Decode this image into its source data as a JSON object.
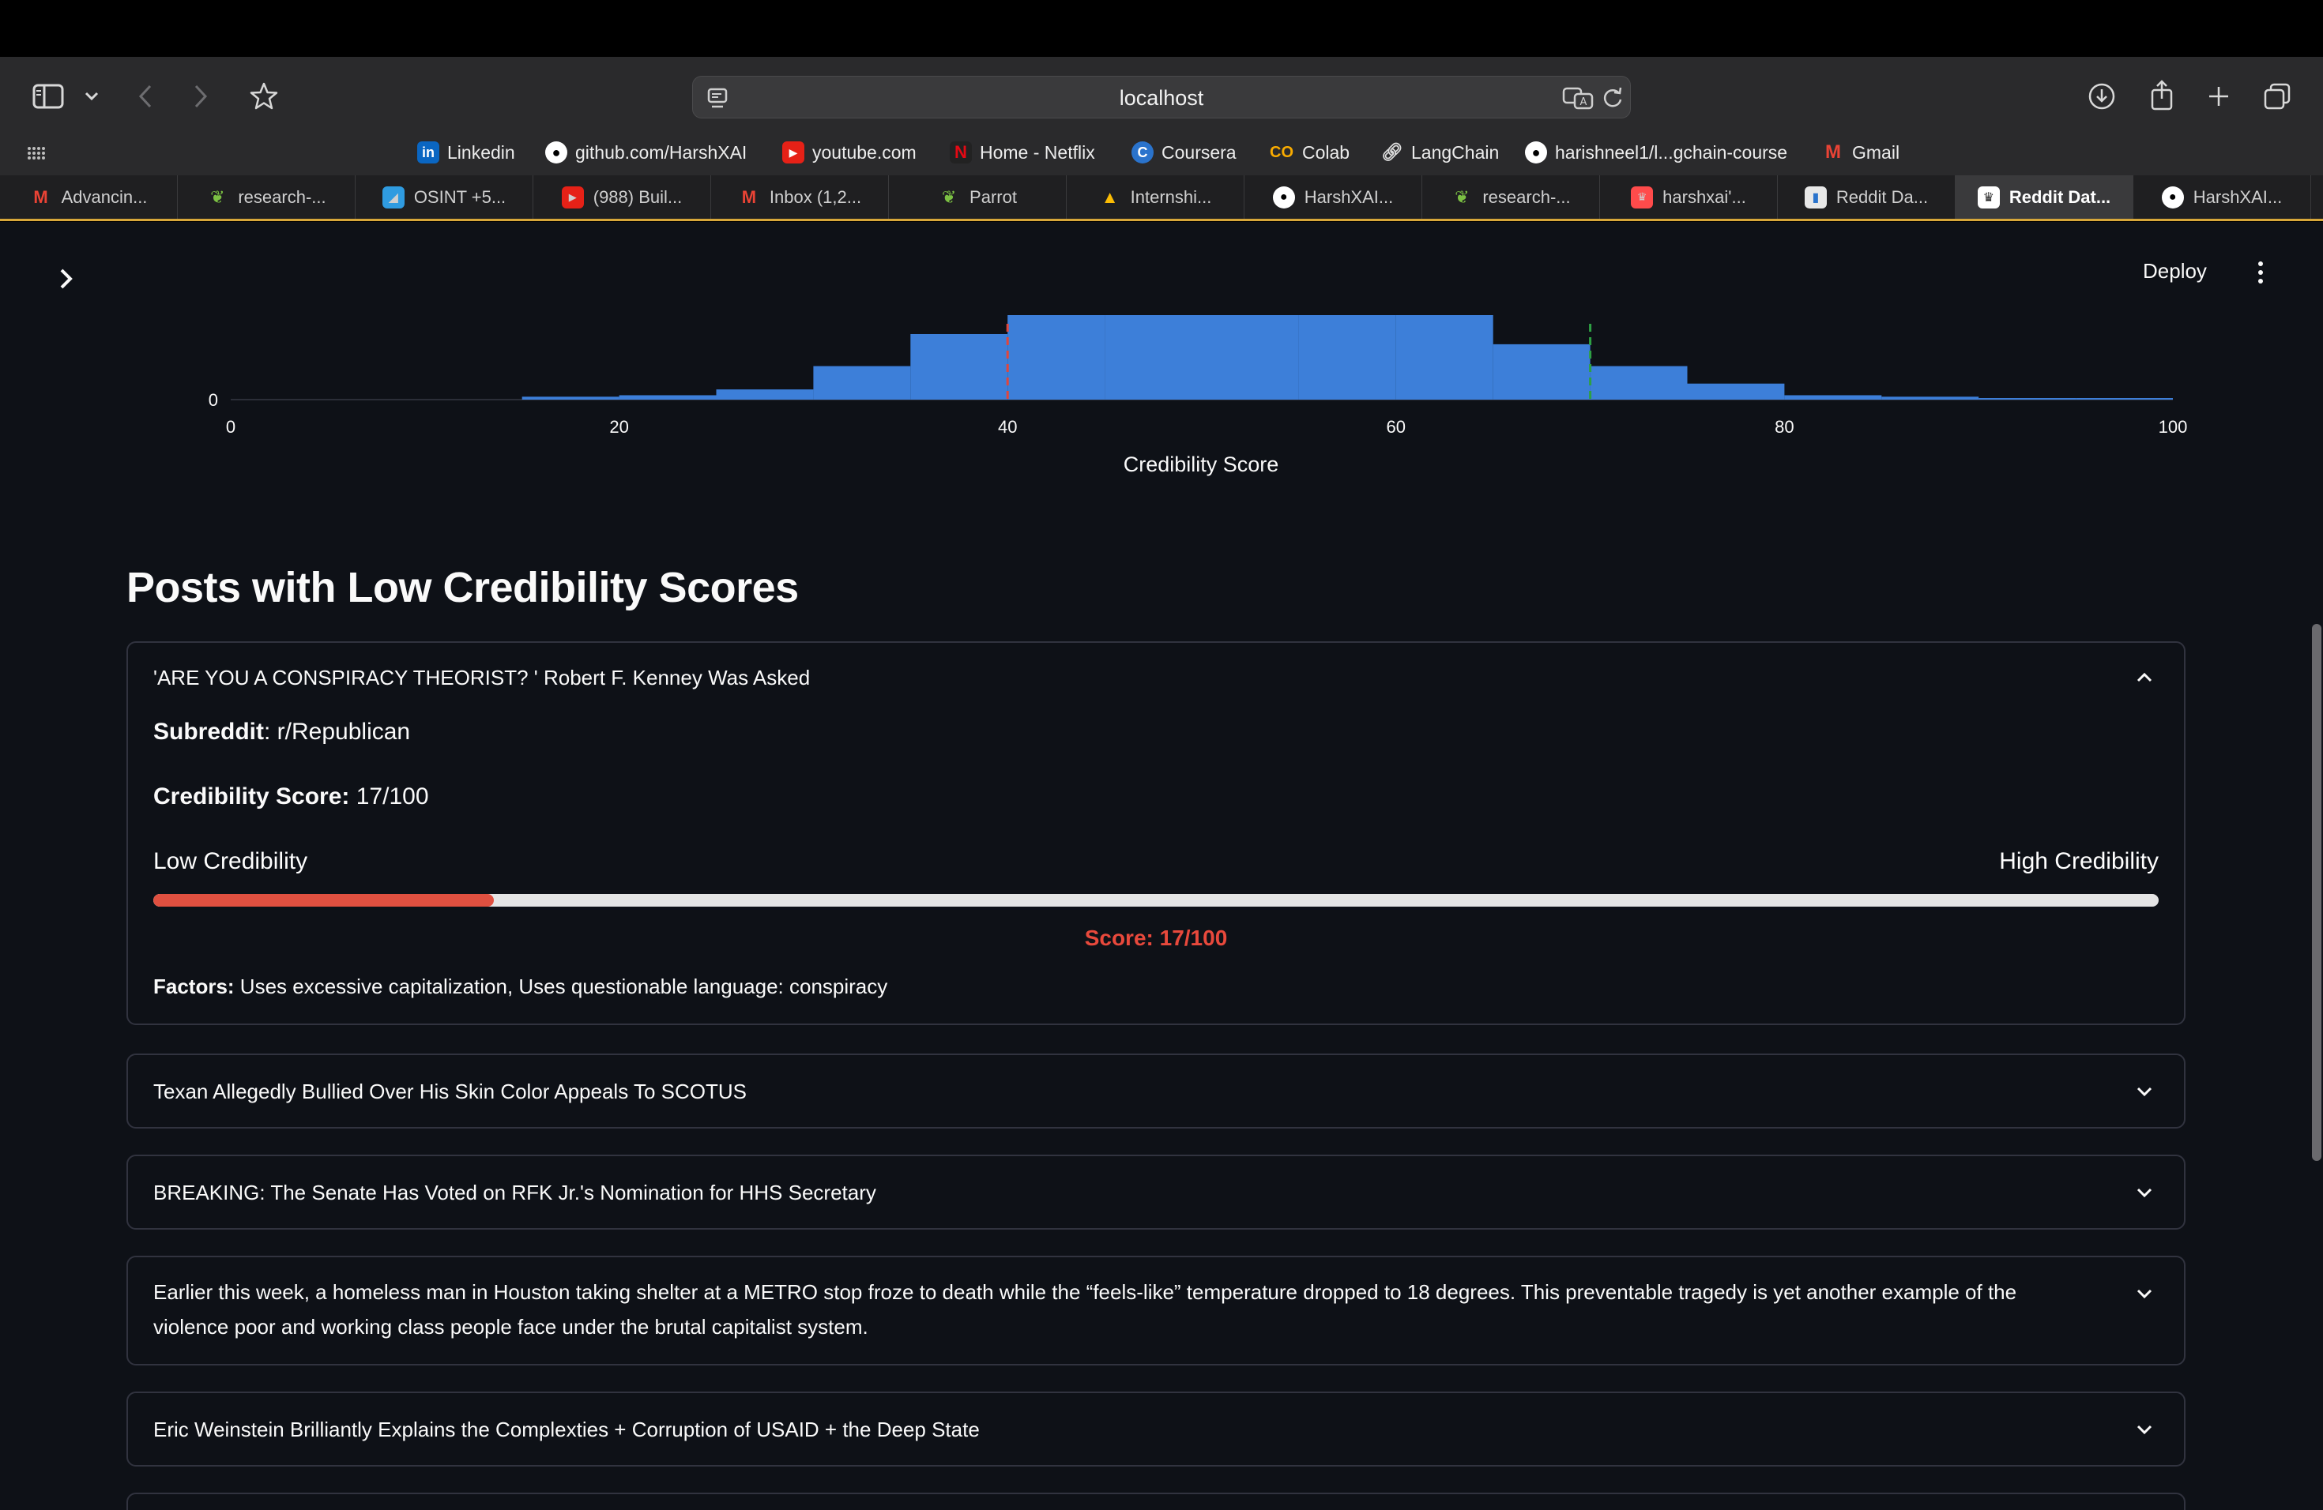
{
  "browser": {
    "url": "localhost",
    "bookmarks": [
      {
        "label": "Linkedin",
        "icon": "linkedin-icon"
      },
      {
        "label": "github.com/HarshXAI",
        "icon": "github-icon"
      },
      {
        "label": "youtube.com",
        "icon": "youtube-icon"
      },
      {
        "label": "Home - Netflix",
        "icon": "netflix-icon"
      },
      {
        "label": "Coursera",
        "icon": "coursera-icon"
      },
      {
        "label": "Colab",
        "icon": "colab-icon"
      },
      {
        "label": "LangChain",
        "icon": "link-icon"
      },
      {
        "label": "harishneel1/l...gchain-course",
        "icon": "github-icon"
      },
      {
        "label": "Gmail",
        "icon": "gmail-icon"
      }
    ],
    "tabs": [
      {
        "label": "Advancin...",
        "icon": "gmail-icon"
      },
      {
        "label": "research-...",
        "icon": "parrot-icon"
      },
      {
        "label": "OSINT +5...",
        "icon": "osint-icon"
      },
      {
        "label": "(988) Buil...",
        "icon": "youtube-icon"
      },
      {
        "label": "Inbox (1,2...",
        "icon": "gmail-icon"
      },
      {
        "label": "Parrot",
        "icon": "parrot-icon"
      },
      {
        "label": "Internshi...",
        "icon": "drive-icon"
      },
      {
        "label": "HarshXAI...",
        "icon": "github-icon"
      },
      {
        "label": "research-...",
        "icon": "parrot-icon"
      },
      {
        "label": "harshxai'...",
        "icon": "streamlit-icon"
      },
      {
        "label": "Reddit Da...",
        "icon": "chart-icon"
      },
      {
        "label": "Reddit Dat...",
        "icon": "streamlit-icon",
        "active": true
      },
      {
        "label": "HarshXAI...",
        "icon": "github-icon"
      }
    ]
  },
  "app": {
    "deploy_label": "Deploy"
  },
  "chart_data": {
    "type": "bar",
    "xlabel": "Credibility Score",
    "x_ticks": [
      "0",
      "20",
      "40",
      "60",
      "80",
      "100"
    ],
    "y_ticks": [
      "0"
    ],
    "xlim": [
      0,
      100
    ],
    "bins": [
      {
        "x0": 15,
        "x1": 20,
        "value": 2
      },
      {
        "x0": 20,
        "x1": 25,
        "value": 3
      },
      {
        "x0": 25,
        "x1": 30,
        "value": 7
      },
      {
        "x0": 30,
        "x1": 35,
        "value": 23
      },
      {
        "x0": 35,
        "x1": 40,
        "value": 45
      },
      {
        "x0": 40,
        "x1": 45,
        "value": 58
      },
      {
        "x0": 45,
        "x1": 50,
        "value": 58
      },
      {
        "x0": 50,
        "x1": 55,
        "value": 58
      },
      {
        "x0": 55,
        "x1": 60,
        "value": 58
      },
      {
        "x0": 60,
        "x1": 65,
        "value": 58
      },
      {
        "x0": 65,
        "x1": 70,
        "value": 38
      },
      {
        "x0": 70,
        "x1": 75,
        "value": 23
      },
      {
        "x0": 75,
        "x1": 80,
        "value": 11
      },
      {
        "x0": 80,
        "x1": 85,
        "value": 3
      },
      {
        "x0": 85,
        "x1": 90,
        "value": 2
      },
      {
        "x0": 90,
        "x1": 95,
        "value": 1
      },
      {
        "x0": 95,
        "x1": 100,
        "value": 1
      }
    ],
    "reference_lines": [
      {
        "x": 40,
        "color": "#e0463c"
      },
      {
        "x": 70,
        "color": "#2ea043"
      }
    ],
    "bar_color": "#3d7fd9"
  },
  "section": {
    "title": "Posts with Low Credibility Scores"
  },
  "posts": [
    {
      "title": "'ARE YOU A CONSPIRACY THEORIST?   ' Robert F. Kenney Was Asked",
      "expanded": true,
      "subreddit_label": "Subreddit",
      "subreddit": ": r/Republican",
      "score_label": "Credibility Score:",
      "score_text": " 17/100",
      "score_value": 17,
      "low_label": "Low Credibility",
      "high_label": "High Credibility",
      "score_line": "Score: 17/100",
      "factors_label": "Factors:",
      "factors": " Uses excessive capitalization, Uses questionable language: conspiracy"
    },
    {
      "title": "Texan Allegedly Bullied Over His Skin Color Appeals To SCOTUS"
    },
    {
      "title": "BREAKING: The Senate Has Voted on RFK Jr.'s Nomination for HHS Secretary"
    },
    {
      "title": "Earlier this week, a homeless man in Houston taking shelter at a METRO stop froze to death while the “feels-like” temperature dropped to 18 degrees. This preventable tragedy is yet another example of the violence poor and working class people face under the brutal capitalist system."
    },
    {
      "title": "Eric Weinstein Brilliantly Explains the Complexties + Corruption of USAID + the Deep State"
    }
  ]
}
